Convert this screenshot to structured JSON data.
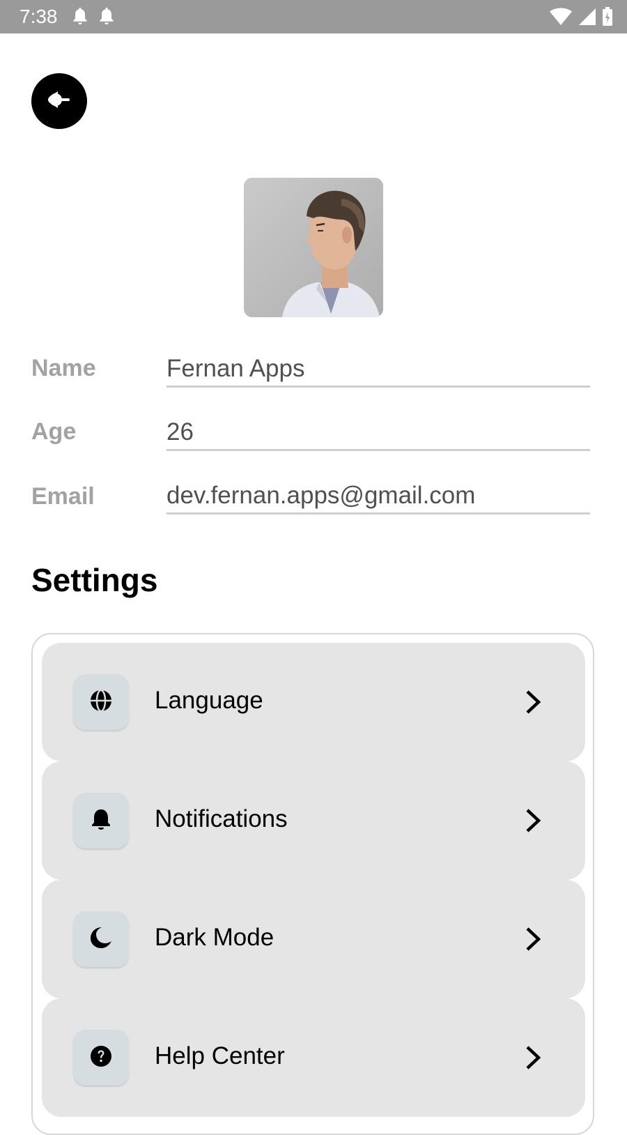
{
  "status_bar": {
    "time": "7:38",
    "left_icons": [
      "notification-bell-icon",
      "notification-bell-icon"
    ],
    "right_icons": [
      "wifi-icon",
      "signal-icon",
      "battery-charging-icon"
    ]
  },
  "header": {
    "back_icon": "back-arrow-icon"
  },
  "profile": {
    "avatar_icon": "profile-photo",
    "fields": [
      {
        "label": "Name",
        "value": "Fernan Apps"
      },
      {
        "label": "Age",
        "value": "26"
      },
      {
        "label": "Email",
        "value": "dev.fernan.apps@gmail.com"
      }
    ]
  },
  "settings": {
    "title": "Settings",
    "items": [
      {
        "label": "Language",
        "icon": "globe-icon"
      },
      {
        "label": "Notifications",
        "icon": "bell-icon"
      },
      {
        "label": "Dark Mode",
        "icon": "moon-icon"
      },
      {
        "label": "Help Center",
        "icon": "help-icon"
      }
    ]
  },
  "colors": {
    "status_bar": "#9a9a9a",
    "item_background": "#e5e5e5",
    "icon_box": "#d5dde1",
    "label_gray": "#a2a2a2",
    "card_border": "#d2d8d8"
  }
}
